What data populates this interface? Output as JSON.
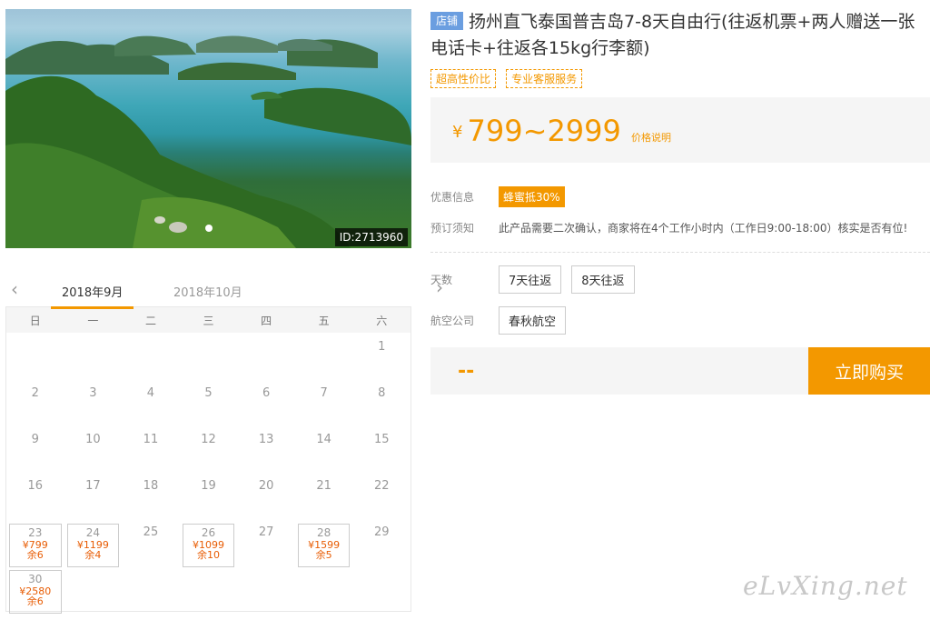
{
  "hero": {
    "photo_id": "ID:2713960",
    "dot_count": 1
  },
  "calendar": {
    "tabs": [
      "2018年9月",
      "2018年10月"
    ],
    "weekdays": [
      "日",
      "一",
      "二",
      "三",
      "四",
      "五",
      "六"
    ],
    "rows": [
      [
        {
          "d": ""
        },
        {
          "d": ""
        },
        {
          "d": ""
        },
        {
          "d": ""
        },
        {
          "d": ""
        },
        {
          "d": ""
        },
        {
          "d": "1"
        }
      ],
      [
        {
          "d": "2"
        },
        {
          "d": "3"
        },
        {
          "d": "4"
        },
        {
          "d": "5"
        },
        {
          "d": "6"
        },
        {
          "d": "7"
        },
        {
          "d": "8"
        }
      ],
      [
        {
          "d": "9"
        },
        {
          "d": "10"
        },
        {
          "d": "11"
        },
        {
          "d": "12"
        },
        {
          "d": "13"
        },
        {
          "d": "14"
        },
        {
          "d": "15"
        }
      ],
      [
        {
          "d": "16"
        },
        {
          "d": "17"
        },
        {
          "d": "18"
        },
        {
          "d": "19"
        },
        {
          "d": "20"
        },
        {
          "d": "21"
        },
        {
          "d": "22"
        }
      ],
      [
        {
          "d": "23",
          "price": "¥799",
          "rem": "余6"
        },
        {
          "d": "24",
          "price": "¥1199",
          "rem": "余4"
        },
        {
          "d": "25"
        },
        {
          "d": "26",
          "price": "¥1099",
          "rem": "余10"
        },
        {
          "d": "27"
        },
        {
          "d": "28",
          "price": "¥1599",
          "rem": "余5"
        },
        {
          "d": "29"
        }
      ],
      [
        {
          "d": "30",
          "price": "¥2580",
          "rem": "余6"
        },
        {
          "d": ""
        },
        {
          "d": ""
        },
        {
          "d": ""
        },
        {
          "d": ""
        },
        {
          "d": ""
        },
        {
          "d": ""
        }
      ]
    ]
  },
  "product": {
    "shop_tag": "店铺",
    "title": "扬州直飞泰国普吉岛7-8天自由行(往返机票+两人赠送一张电话卡+往返各15kg行李额)",
    "tags": [
      "超高性价比",
      "专业客服服务"
    ],
    "price_currency": "¥",
    "price_range": "799~2999",
    "price_explain": "价格说明",
    "discount_label": "优惠信息",
    "discount_value": "蜂蜜抵30%",
    "notice_label": "预订须知",
    "notice_text": "此产品需要二次确认，商家将在4个工作小时内（工作日9:00-18:00）核实是否有位!",
    "days_label": "天数",
    "days_options": [
      "7天往返",
      "8天往返"
    ],
    "airline_label": "航空公司",
    "airline_options": [
      "春秋航空"
    ],
    "selected_price": "--",
    "buy_label": "立即购买"
  },
  "watermark": "eLvXing.net",
  "colors": {
    "accent": "#f39800",
    "shop_tag": "#6b9ee0",
    "price_text": "#e85d05"
  }
}
